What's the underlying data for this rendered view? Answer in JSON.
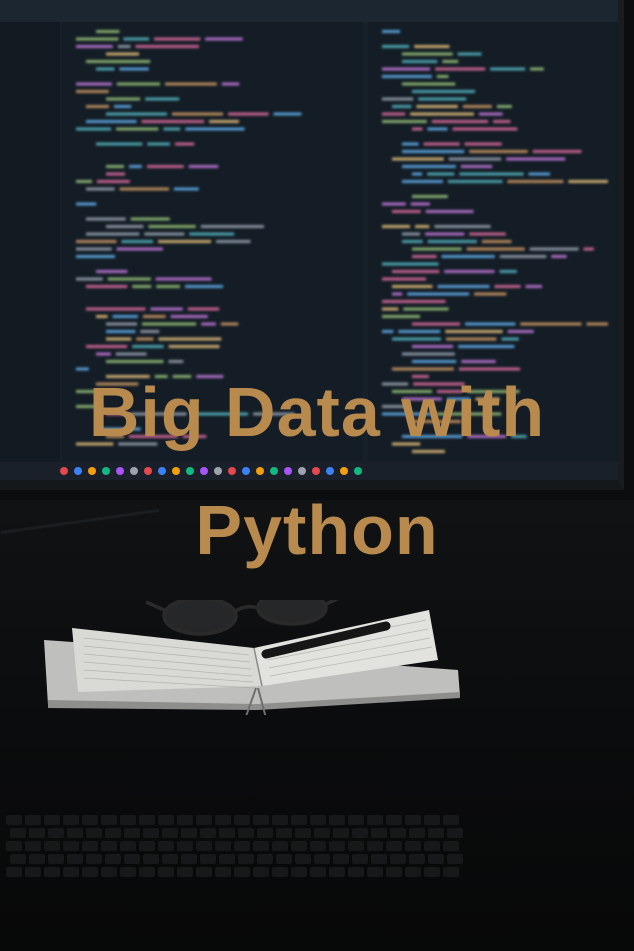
{
  "cover": {
    "title_line1": "Big Data with",
    "title_line2": "Python"
  },
  "colors": {
    "title": "#b88a4e",
    "screen_bg": "#162029",
    "desk": "#0c0d0e"
  },
  "icons": [
    "glasses-icon",
    "pen-icon",
    "notebook-icon",
    "keyboard-icon",
    "monitor-icon"
  ]
}
